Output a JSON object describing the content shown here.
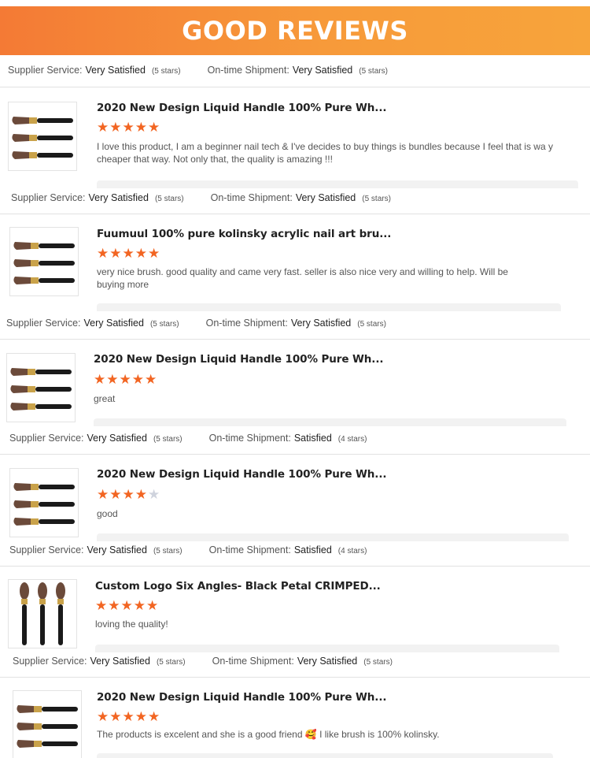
{
  "banner": {
    "title": "GOOD REVIEWS"
  },
  "labels": {
    "supplier": "Supplier Service:",
    "shipment": "On-time Shipment:"
  },
  "top_summary": {
    "supplier_value": "Very Satisfied",
    "supplier_note": "(5 stars)",
    "shipment_value": "Very Satisfied",
    "shipment_note": "(5 stars)"
  },
  "reviews": [
    {
      "title": "2020 New Design Liquid Handle 100% Pure Wh...",
      "rating": 5,
      "text": "I love this product, I am a beginner nail tech & I've decides to buy things is bundles because I feel that is wa y cheaper that way. Not only that, the quality is amazing !!!",
      "thumb_icon": "brush-set-icon",
      "supplier_value": "Very Satisfied",
      "supplier_note": "(5 stars)",
      "shipment_value": "Very Satisfied",
      "shipment_note": "(5 stars)"
    },
    {
      "title": "Fuumuul 100% pure kolinsky acrylic nail art bru...",
      "rating": 5,
      "text": "very nice brush. good quality and came very fast. seller is also nice very and willing to help. Will be buying more",
      "thumb_icon": "brush-set-icon",
      "supplier_value": "Very Satisfied",
      "supplier_note": "(5 stars)",
      "shipment_value": "Very Satisfied",
      "shipment_note": "(5 stars)"
    },
    {
      "title": "2020 New Design Liquid Handle 100% Pure Wh...",
      "rating": 5,
      "text": "great",
      "thumb_icon": "brush-set-icon",
      "supplier_value": "Very Satisfied",
      "supplier_note": "(5 stars)",
      "shipment_value": "Satisfied",
      "shipment_note": "(4 stars)"
    },
    {
      "title": "2020 New Design Liquid Handle 100% Pure Wh...",
      "rating": 4,
      "text": "good",
      "thumb_icon": "brush-set-icon",
      "supplier_value": "Very Satisfied",
      "supplier_note": "(5 stars)",
      "shipment_value": "Satisfied",
      "shipment_note": "(4 stars)"
    },
    {
      "title": "Custom Logo Six Angles- Black Petal CRIMPED...",
      "rating": 5,
      "text": "loving the quality!",
      "thumb_icon": "vertical-brushes-icon",
      "supplier_value": "Very Satisfied",
      "supplier_note": "(5 stars)",
      "shipment_value": "Very Satisfied",
      "shipment_note": "(5 stars)"
    },
    {
      "title": "2020 New Design Liquid Handle 100% Pure Wh...",
      "rating": 5,
      "text": "The products is excelent and she is a good friend 🥰 I like brush is 100% kolinsky.",
      "thumb_icon": "brush-set-icon"
    }
  ],
  "colors": {
    "accent": "#f26522",
    "banner_start": "#f47a35",
    "banner_end": "#f7a43b",
    "star_off": "#cfd3dd"
  }
}
